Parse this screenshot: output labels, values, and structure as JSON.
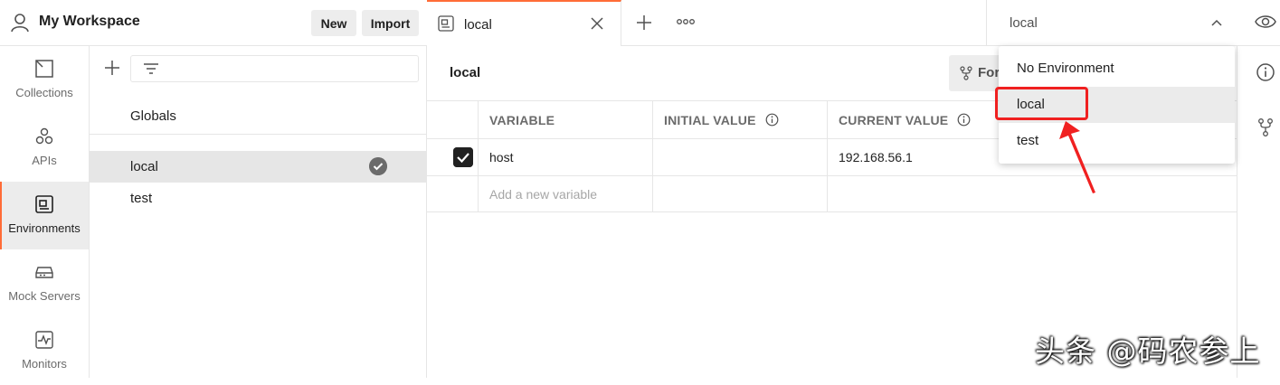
{
  "header": {
    "workspace_title": "My Workspace",
    "new_label": "New",
    "import_label": "Import"
  },
  "rail": [
    {
      "label": "Collections",
      "icon": "collections-icon"
    },
    {
      "label": "APIs",
      "icon": "apis-icon"
    },
    {
      "label": "Environments",
      "icon": "environments-icon",
      "active": true
    },
    {
      "label": "Mock Servers",
      "icon": "mock-servers-icon"
    },
    {
      "label": "Monitors",
      "icon": "monitors-icon"
    }
  ],
  "env_panel": {
    "globals_label": "Globals",
    "environments": [
      {
        "name": "local",
        "active": true
      },
      {
        "name": "test",
        "active": false
      }
    ]
  },
  "tab": {
    "label": "local"
  },
  "env_selector": {
    "selected": "local"
  },
  "editor": {
    "env_name": "local",
    "fork_label": "Fork",
    "columns": [
      "VARIABLE",
      "INITIAL VALUE",
      "CURRENT VALUE"
    ],
    "rows": [
      {
        "checked": true,
        "variable": "host",
        "initial_value": "",
        "current_value": "192.168.56.1"
      }
    ],
    "add_placeholder": "Add a new variable"
  },
  "dropdown": {
    "items": [
      "No Environment",
      "local",
      "test"
    ],
    "highlighted": "local"
  },
  "watermark": "头条 @码农参上",
  "colors": {
    "accent": "#ff6c37",
    "highlight": "#f02020"
  }
}
